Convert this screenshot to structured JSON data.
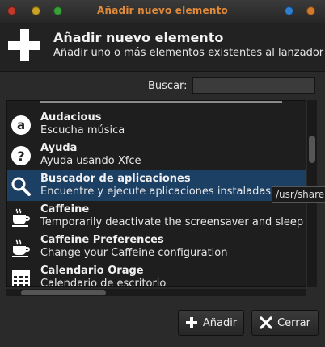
{
  "window": {
    "title": "Añadir nuevo elemento",
    "buttons": [
      {
        "name": "close-window-button",
        "color": "#c0392b"
      },
      {
        "name": "minimize-window-button",
        "color": "#c9a227"
      },
      {
        "name": "maximize-window-button",
        "color": "#3aa13a"
      },
      {
        "name": "sticky-button",
        "color": "#2f7fd0"
      },
      {
        "name": "menu-button",
        "color": "#d0792f"
      }
    ]
  },
  "header": {
    "title": "Añadir nuevo elemento",
    "subtitle": "Añadir uno o más elementos existentes al lanzador",
    "icon": "plus-icon"
  },
  "search": {
    "label": "Buscar:",
    "value": "",
    "placeholder": ""
  },
  "items": [
    {
      "name": "Audacious",
      "desc": "Escucha música",
      "icon": "audacious-icon"
    },
    {
      "name": "Ayuda",
      "desc": "Ayuda usando Xfce",
      "icon": "help-icon"
    },
    {
      "name": "Buscador de aplicaciones",
      "desc": "Encuentre y ejecute aplicaciones instaladas en su sistema",
      "icon": "search-icon",
      "selected": true
    },
    {
      "name": "Caffeine",
      "desc": "Temporarily deactivate the screensaver and sleep mode",
      "icon": "coffee-icon"
    },
    {
      "name": "Caffeine Preferences",
      "desc": "Change your Caffeine configuration",
      "icon": "coffee-icon"
    },
    {
      "name": "Calendario Orage",
      "desc": "Calendario de escritorio",
      "icon": "calendar-icon"
    }
  ],
  "tooltip": "/usr/share",
  "buttons": {
    "add": "Añadir",
    "close": "Cerrar"
  }
}
